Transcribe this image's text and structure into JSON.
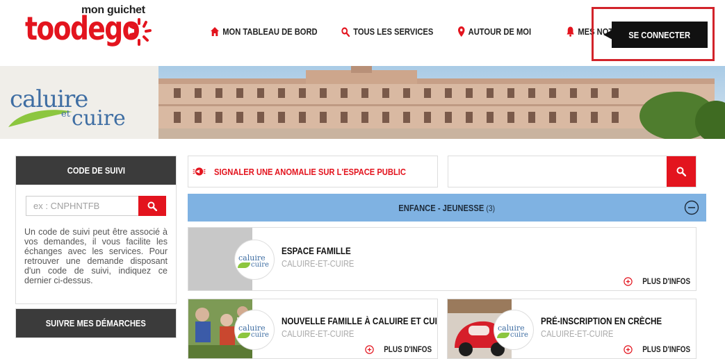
{
  "header": {
    "logo_sup": "mon guichet",
    "logo_word": "toodego",
    "nav": [
      {
        "label": "MON TABLEAU DE BORD",
        "icon": "home-icon"
      },
      {
        "label": "TOUS LES SERVICES",
        "icon": "search-icon"
      },
      {
        "label": "AUTOUR DE MOI",
        "icon": "map-pin-icon"
      },
      {
        "label": "MES NOTIFICATIONS",
        "icon": "bell-icon"
      }
    ],
    "login_label": "SE CONNECTER"
  },
  "banner": {
    "city_line1": "caluire",
    "city_et": "et",
    "city_line2": "cuire"
  },
  "sidebar": {
    "tracking_title": "CODE DE SUIVI",
    "tracking_placeholder": "ex : CNPHNTFB",
    "tracking_help": "Un code de suivi peut être associé à vos demandes, il vous facilite les échanges avec les services. Pour retrouver une demande disposant d'un code de suivi, indiquez ce dernier ci-dessus.",
    "follow_title": "SUIVRE MES DÉMARCHES"
  },
  "main": {
    "report_label": "SIGNALER UNE ANOMALIE SUR L'ESPACE PUBLIC",
    "search_placeholder": "",
    "category": {
      "label": "ENFANCE - JEUNESSE",
      "count": "(3)"
    },
    "cards": [
      {
        "title": "ESPACE FAMILLE",
        "subtitle": "CALUIRE-ET-CUIRE",
        "more": "PLUS D'INFOS"
      },
      {
        "title": "NOUVELLE FAMILLE À CALUIRE ET CUIRE ?",
        "subtitle": "CALUIRE-ET-CUIRE",
        "more": "PLUS D'INFOS"
      },
      {
        "title": "PRÉ-INSCRIPTION EN CRÈCHE",
        "subtitle": "CALUIRE-ET-CUIRE",
        "more": "PLUS D'INFOS"
      }
    ],
    "circle_logo": {
      "l1": "caluire",
      "l2": "cuire"
    }
  },
  "colors": {
    "brand_red": "#e3141e",
    "category_blue": "#7fb2e2",
    "dark": "#3b3b3b"
  }
}
